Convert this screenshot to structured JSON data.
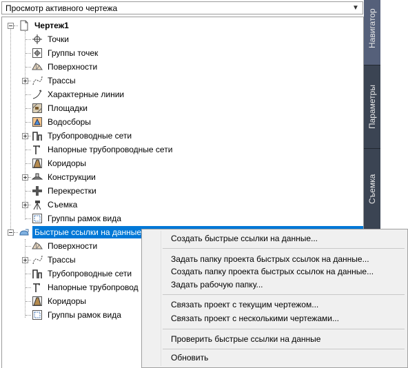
{
  "dropdown": {
    "value": "Просмотр активного чертежа"
  },
  "tree": {
    "root_label": "Чертеж1",
    "items": [
      {
        "label": "Точки",
        "icon": "points-icon"
      },
      {
        "label": "Группы точек",
        "icon": "point-groups-icon"
      },
      {
        "label": "Поверхности",
        "icon": "surfaces-icon"
      },
      {
        "label": "Трассы",
        "icon": "alignments-icon"
      },
      {
        "label": "Характерные линии",
        "icon": "feature-lines-icon"
      },
      {
        "label": "Площадки",
        "icon": "sites-icon"
      },
      {
        "label": "Водосборы",
        "icon": "catchments-icon"
      },
      {
        "label": "Трубопроводные сети",
        "icon": "pipe-networks-icon"
      },
      {
        "label": "Напорные трубопроводные сети",
        "icon": "pressure-networks-icon"
      },
      {
        "label": "Коридоры",
        "icon": "corridors-icon"
      },
      {
        "label": "Конструкции",
        "icon": "assemblies-icon"
      },
      {
        "label": "Перекрестки",
        "icon": "intersections-icon"
      },
      {
        "label": "Съемка",
        "icon": "survey-icon"
      },
      {
        "label": "Группы рамок вида",
        "icon": "view-frame-groups-icon"
      }
    ],
    "shortcuts_label": "Быстрые ссылки на данные",
    "shortcut_items": [
      {
        "label": "Поверхности"
      },
      {
        "label": "Трассы"
      },
      {
        "label": "Трубопроводные сети"
      },
      {
        "label": "Напорные трубопровод"
      },
      {
        "label": "Коридоры"
      },
      {
        "label": "Группы рамок вида"
      }
    ]
  },
  "tabs": {
    "navigator": "Навигатор",
    "settings": "Параметры",
    "survey": "Съемка"
  },
  "context_menu": {
    "items": [
      "Создать быстрые ссылки на данные...",
      "Задать папку проекта быстрых ссылок на данные...",
      "Создать папку проекта быстрых ссылок на данные...",
      "Задать рабочую папку...",
      "Связать проект с текущим чертежом...",
      "Связать проект с несколькими чертежами...",
      "Проверить быстрые ссылки на данные",
      "Обновить"
    ]
  },
  "colors": {
    "selection": "#0078d7",
    "tab_strip": "#3b4453",
    "menu_bg": "#f0f0f0"
  }
}
